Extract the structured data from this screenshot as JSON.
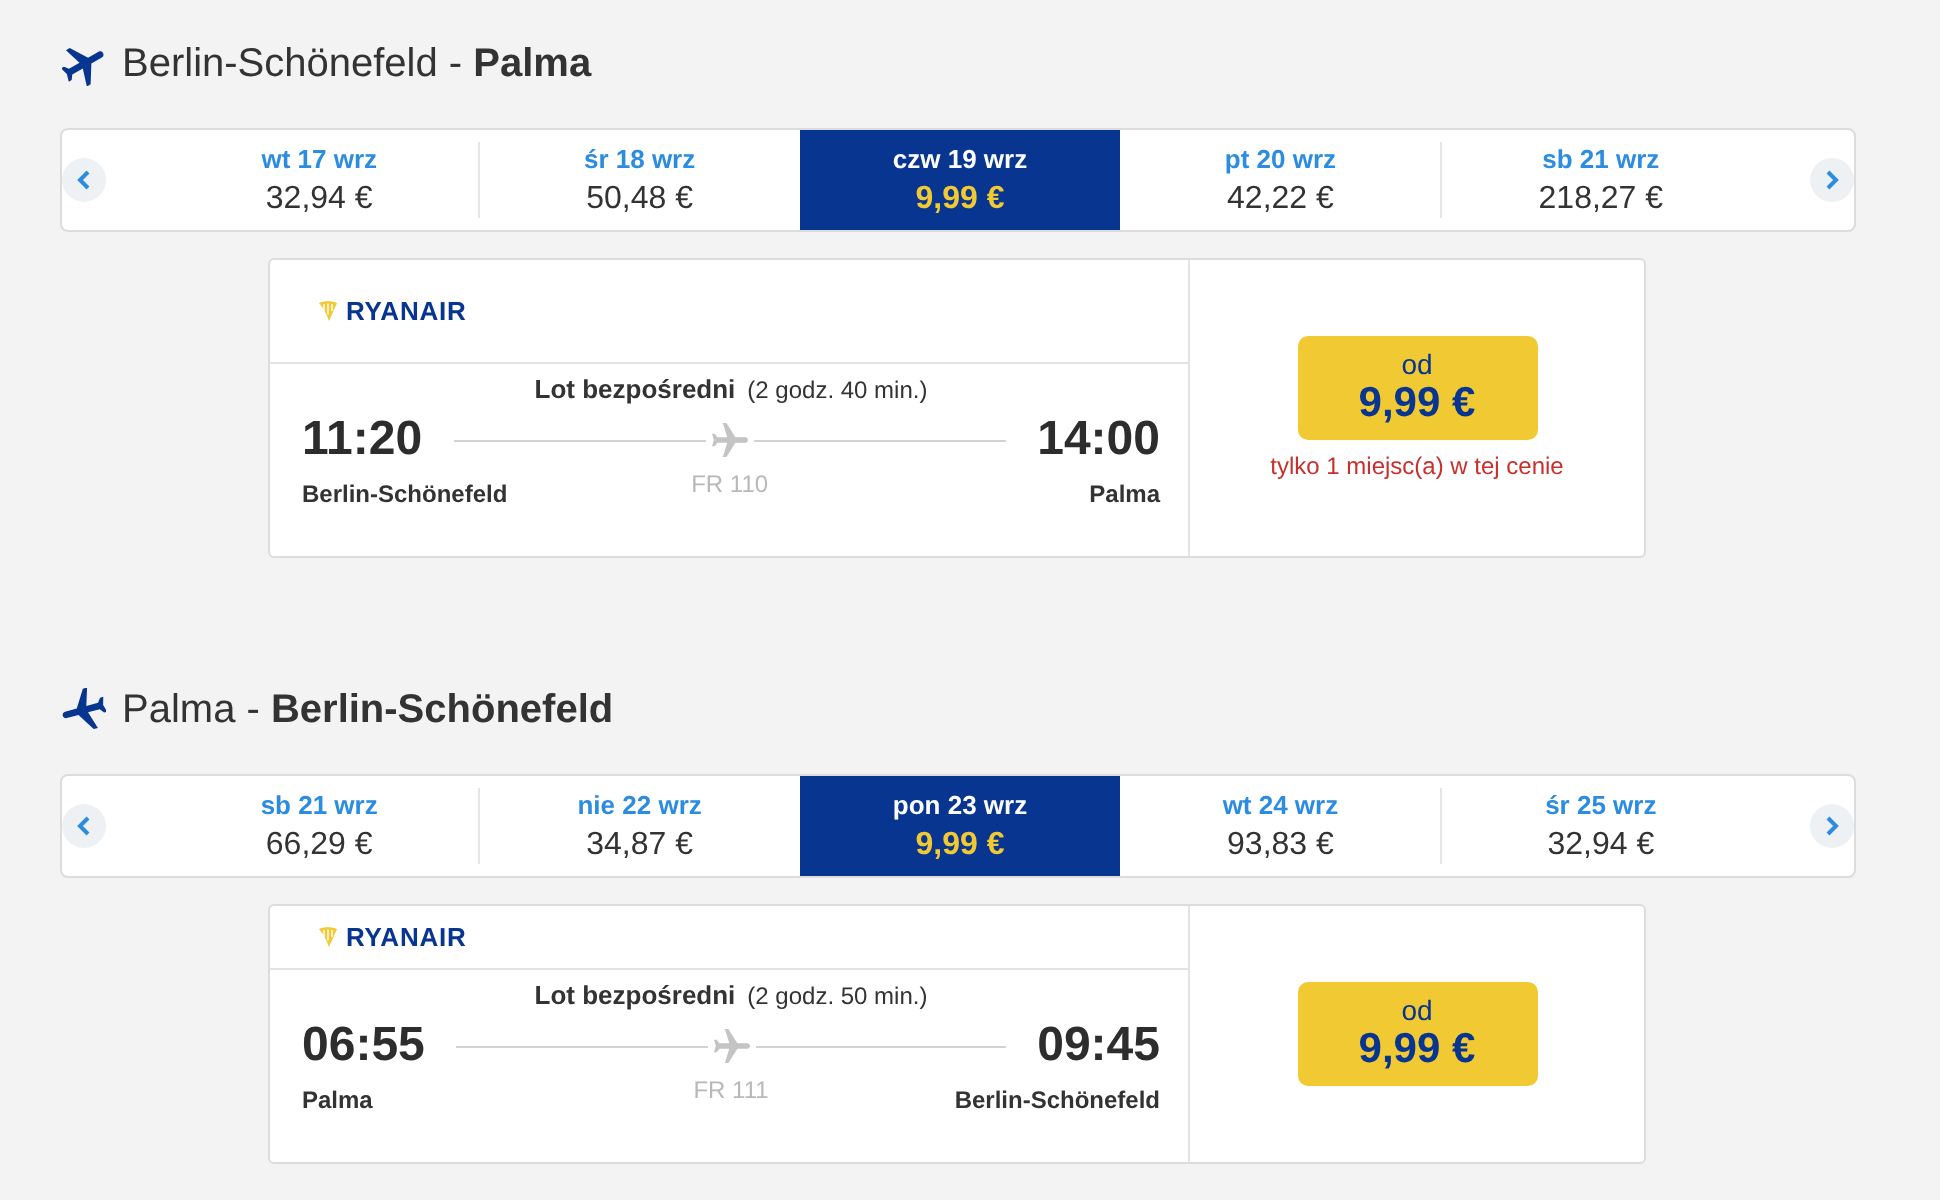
{
  "legs": [
    {
      "kind": "outbound",
      "heading": "Berlin-Schönefeld - **Palma**",
      "dates": [
        {
          "day": "wt 17 wrz",
          "price": "32,94 €",
          "selected": false
        },
        {
          "day": "śr 18 wrz",
          "price": "50,48 €",
          "selected": false
        },
        {
          "day": "czw 19 wrz",
          "price": "9,99 €",
          "selected": true
        },
        {
          "day": "pt 20 wrz",
          "price": "42,22 €",
          "selected": false
        },
        {
          "day": "sb 21 wrz",
          "price": "218,27 €",
          "selected": false
        }
      ],
      "flight": {
        "airline": "RYANAIR",
        "stops": "Lot bezpośredni",
        "duration": "(2 godz. 40 min.)",
        "departure_time": "11:20",
        "departure_city": "Berlin-Schönefeld",
        "flight_number": "FR 110",
        "arrival_time": "14:00",
        "arrival_city": "Palma"
      },
      "fare": {
        "label": "od",
        "price": "9,99 €",
        "note": "tylko 1 miejsc(a) w tej cenie"
      }
    },
    {
      "kind": "return",
      "heading": "Palma - **Berlin-Schönefeld**",
      "dates": [
        {
          "day": "sb 21 wrz",
          "price": "66,29 €",
          "selected": false
        },
        {
          "day": "nie 22 wrz",
          "price": "34,87 €",
          "selected": false
        },
        {
          "day": "pon 23 wrz",
          "price": "9,99 €",
          "selected": true
        },
        {
          "day": "wt 24 wrz",
          "price": "93,83 €",
          "selected": false
        },
        {
          "day": "śr 25 wrz",
          "price": "32,94 €",
          "selected": false
        }
      ],
      "flight": {
        "airline": "RYANAIR",
        "stops": "Lot bezpośredni",
        "duration": "(2 godz. 50 min.)",
        "departure_time": "06:55",
        "departure_city": "Palma",
        "flight_number": "FR 111",
        "arrival_time": "09:45",
        "arrival_city": "Berlin-Schönefeld"
      },
      "fare": {
        "label": "od",
        "price": "9,99 €"
      }
    }
  ]
}
